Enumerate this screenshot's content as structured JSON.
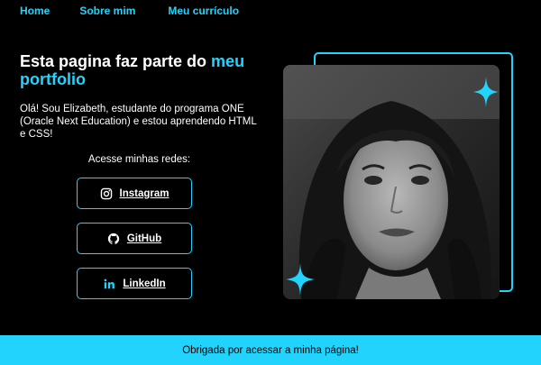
{
  "nav": {
    "home": "Home",
    "about": "Sobre mim",
    "resume": "Meu currículo"
  },
  "hero": {
    "title_main": "Esta pagina faz parte do ",
    "title_accent": "meu portfolio",
    "intro": "Olá! Sou Elizabeth, estudante do programa ONE (Oracle Next Education) e estou aprendendo HTML e CSS!",
    "networks_label": "Acesse minhas redes:"
  },
  "social": [
    {
      "label": "Instagram",
      "icon": "instagram-icon"
    },
    {
      "label": "GitHub",
      "icon": "github-icon"
    },
    {
      "label": "LinkedIn",
      "icon": "linkedin-icon"
    }
  ],
  "footer": {
    "text": "Obrigada por acessar a minha página!"
  },
  "colors": {
    "accent": "#22d4fd",
    "background": "#000000",
    "text": "#ffffff"
  }
}
